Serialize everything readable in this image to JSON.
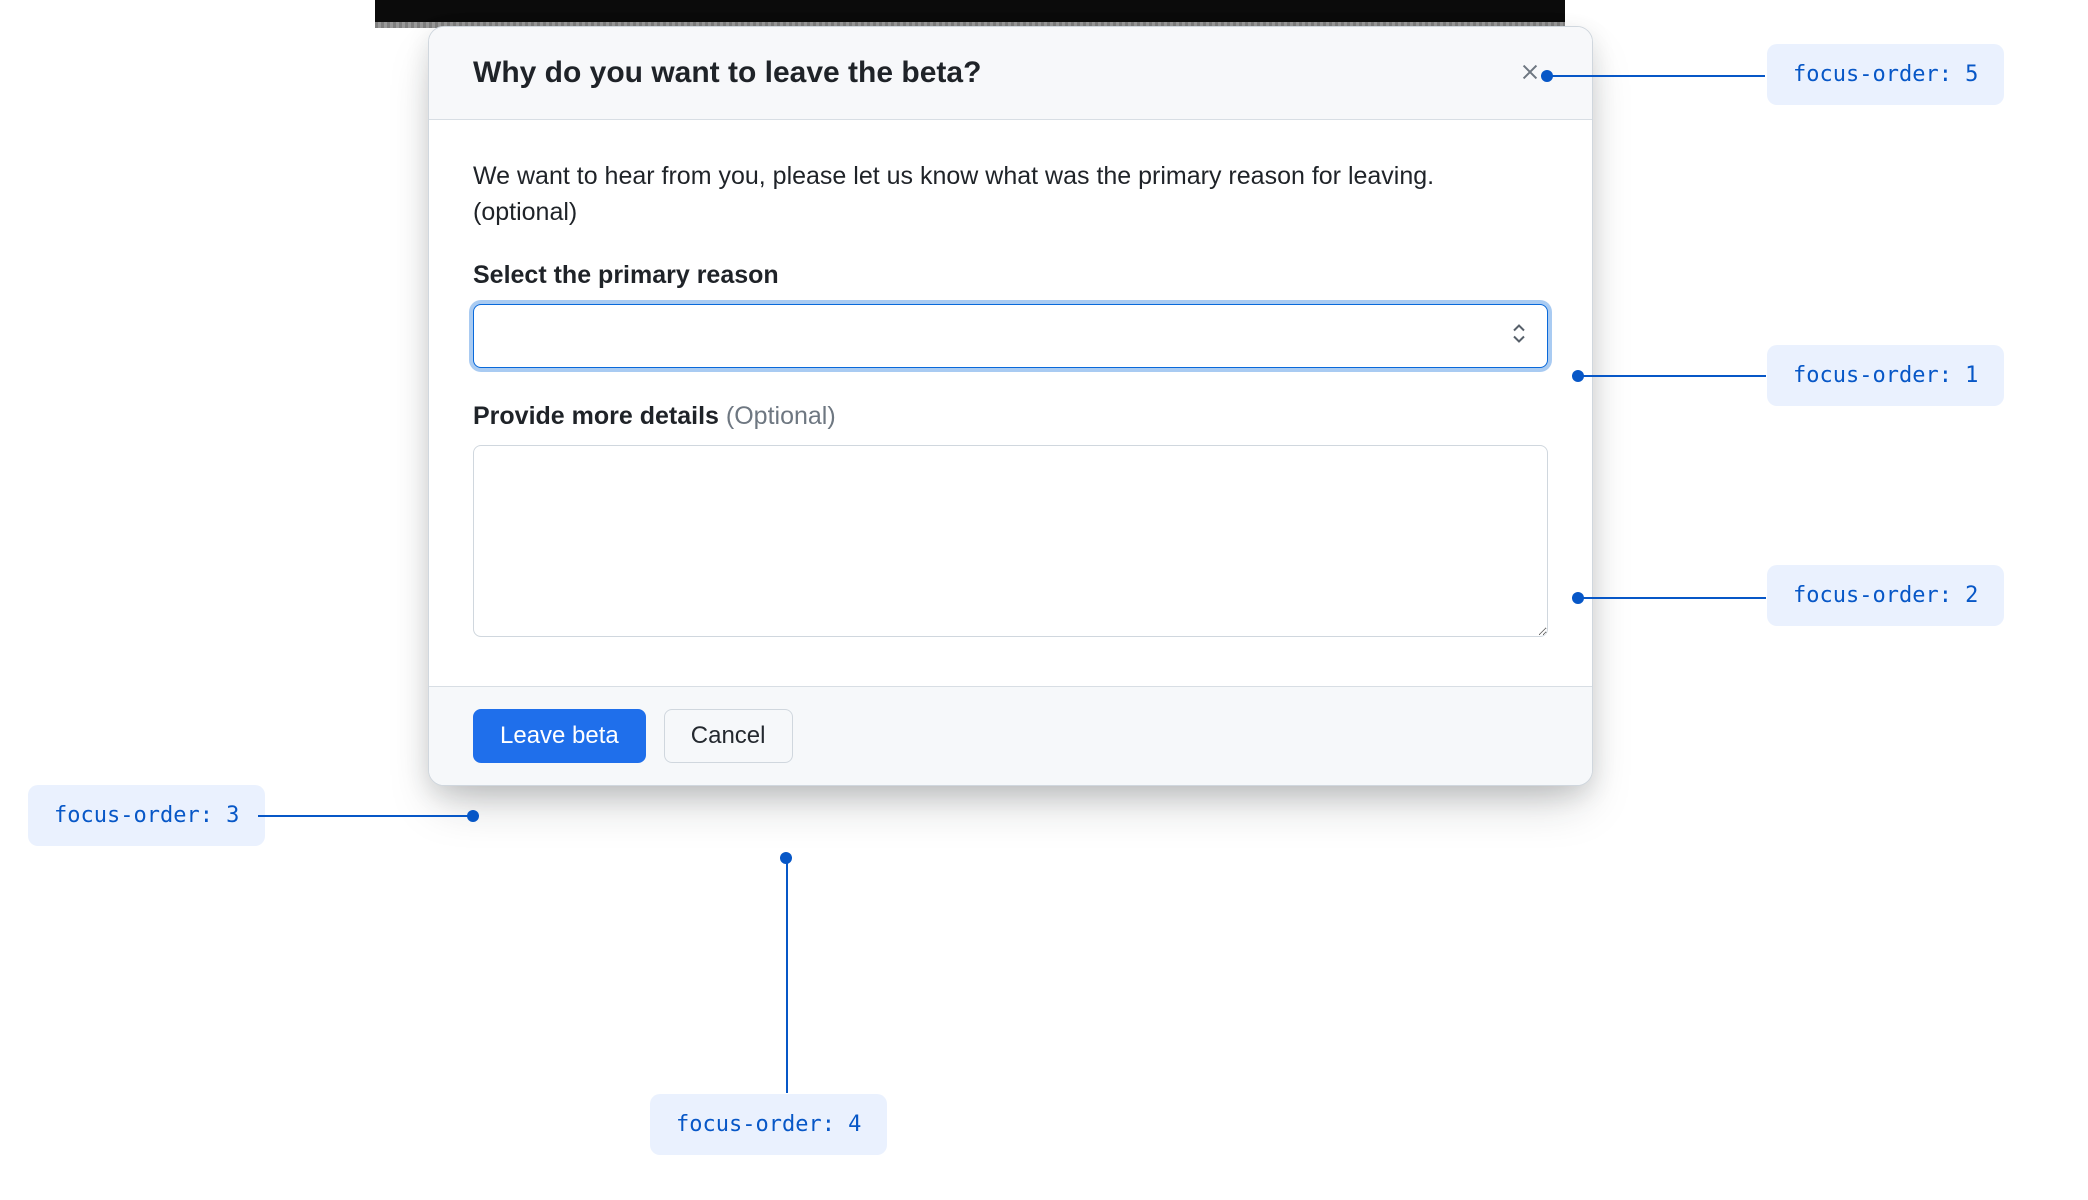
{
  "dialog": {
    "title": "Why do you want to leave the beta?",
    "intro": "We want to hear from you, please let us know what was the primary reason for leaving. (optional)",
    "select_label": "Select the primary reason",
    "select_value": "",
    "details_label": "Provide more details",
    "details_optional": "(Optional)",
    "details_value": "",
    "primary_button": "Leave beta",
    "secondary_button": "Cancel"
  },
  "annotations": {
    "close": "focus-order: 5",
    "select": "focus-order: 1",
    "textarea": "focus-order: 2",
    "primary": "focus-order: 3",
    "secondary": "focus-order: 4"
  }
}
